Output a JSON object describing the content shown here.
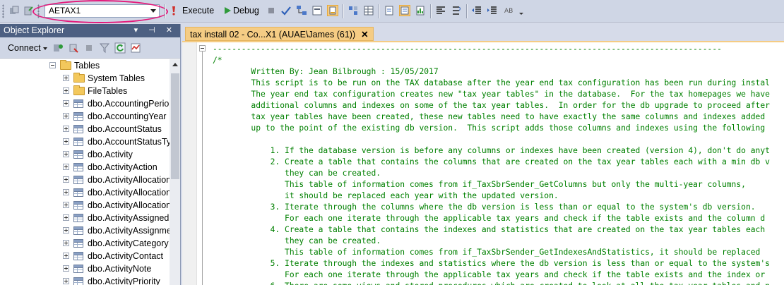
{
  "toolbar": {
    "database": "AETAX1",
    "execute_label": "Execute",
    "debug_label": "Debug",
    "icons": [
      "connect-icon",
      "disconnect-icon",
      "database-dropdown",
      "execute-icon",
      "debug-icon",
      "stop-icon",
      "parse-check-icon",
      "display-plan-icon",
      "query-designer-icon",
      "intellisense-icon",
      "results-to-text-icon",
      "results-to-grid-icon",
      "results-to-file-icon",
      "comment-icon",
      "uncomment-icon",
      "decrease-indent-icon",
      "increase-indent-icon",
      "specify-values-icon"
    ],
    "highlight_color": "#e4187a"
  },
  "object_explorer": {
    "title": "Object Explorer",
    "header_controls": "▾ ⊣ ✕",
    "connect_label": "Connect",
    "tree": [
      {
        "label": "Tables",
        "icon": "folder",
        "expander": "minus",
        "level": 0
      },
      {
        "label": "System Tables",
        "icon": "folder",
        "expander": "plus",
        "level": 1
      },
      {
        "label": "FileTables",
        "icon": "folder",
        "expander": "plus",
        "level": 1
      },
      {
        "label": "dbo.AccountingPerio",
        "icon": "table",
        "expander": "plus",
        "level": 1
      },
      {
        "label": "dbo.AccountingYear",
        "icon": "table",
        "expander": "plus",
        "level": 1
      },
      {
        "label": "dbo.AccountStatus",
        "icon": "table",
        "expander": "plus",
        "level": 1
      },
      {
        "label": "dbo.AccountStatusTy",
        "icon": "table",
        "expander": "plus",
        "level": 1
      },
      {
        "label": "dbo.Activity",
        "icon": "table",
        "expander": "plus",
        "level": 1
      },
      {
        "label": "dbo.ActivityAction",
        "icon": "table",
        "expander": "plus",
        "level": 1
      },
      {
        "label": "dbo.ActivityAllocation",
        "icon": "table",
        "expander": "plus",
        "level": 1
      },
      {
        "label": "dbo.ActivityAllocation",
        "icon": "table",
        "expander": "plus",
        "level": 1
      },
      {
        "label": "dbo.ActivityAllocation",
        "icon": "table",
        "expander": "plus",
        "level": 1
      },
      {
        "label": "dbo.ActivityAssigned",
        "icon": "table",
        "expander": "plus",
        "level": 1
      },
      {
        "label": "dbo.ActivityAssignme",
        "icon": "table",
        "expander": "plus",
        "level": 1
      },
      {
        "label": "dbo.ActivityCategory",
        "icon": "table",
        "expander": "plus",
        "level": 1
      },
      {
        "label": "dbo.ActivityContact",
        "icon": "table",
        "expander": "plus",
        "level": 1
      },
      {
        "label": "dbo.ActivityNote",
        "icon": "table",
        "expander": "plus",
        "level": 1
      },
      {
        "label": "dbo.ActivityPriority",
        "icon": "table",
        "expander": "plus",
        "level": 1
      }
    ]
  },
  "editor": {
    "tab_label": "tax install 02 - Co...X1 (AUAE\\James (61))",
    "tab_close": "✕",
    "code_color": "#008000",
    "lines": [
      "----------------------------------------------------------------------------------------------------------",
      "/*",
      "        Written By: Jean Bilbrough : 15/05/2017",
      "        This script is to be run on the TAX database after the year end tax configuration has been run during instal",
      "        The year end tax configuration creates new \"tax year tables\" in the database.  For the tax homepages we have",
      "        additional columns and indexes on some of the tax year tables.  In order for the db upgrade to proceed after",
      "        tax year tables have been created, these new tables need to have exactly the same columns and indexes added",
      "        up to the point of the existing db version.  This script adds those columns and indexes using the following",
      "",
      "            1. If the database version is before any columns or indexes have been created (version 4), don't do anyt",
      "            2. Create a table that contains the columns that are created on the tax year tables each with a min db v",
      "               they can be created.",
      "               This table of information comes from if_TaxSbrSender_GetColumns but only the multi-year columns,",
      "               it should be replaced each year with the updated version.",
      "            3. Iterate through the columns where the db version is less than or equal to the system's db version.",
      "               For each one iterate through the applicable tax years and check if the table exists and the column d",
      "            4. Create a table that contains the indexes and statistics that are created on the tax year tables each",
      "               they can be created.",
      "               This table of information comes from if_TaxSbrSender_GetIndexesAndStatistics, it should be replaced",
      "            5. Iterate through the indexes and statistics where the db version is less than or equal to the system's",
      "               For each one iterate through the applicable tax years and check if the table exists and the index or",
      "            6. There are some views and stored procedures which are created to look at all the tax year tables and n"
    ]
  }
}
